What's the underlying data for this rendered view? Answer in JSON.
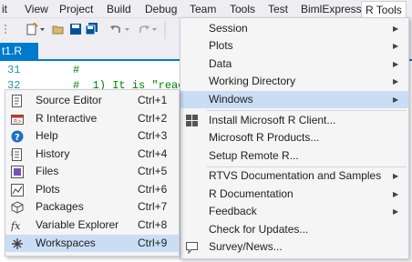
{
  "menubar": {
    "items": [
      "it",
      "View",
      "Project",
      "Build",
      "Debug",
      "Team",
      "Tools",
      "Test",
      "BimlExpress",
      "R Tools"
    ]
  },
  "tab": {
    "label": "t1.R"
  },
  "editor": {
    "lines": [
      {
        "num": "31",
        "code": "#"
      },
      {
        "num": "32",
        "code": "#  1) It is \"reacti"
      }
    ]
  },
  "rtools_menu": {
    "items": [
      {
        "label": "Session",
        "submenu": true
      },
      {
        "label": "Plots",
        "submenu": true
      },
      {
        "label": "Data",
        "submenu": true
      },
      {
        "label": "Working Directory",
        "submenu": true
      },
      {
        "label": "Windows",
        "submenu": true
      },
      {
        "label": "Install Microsoft R Client...",
        "submenu": false
      },
      {
        "label": "Microsoft R Products...",
        "submenu": false
      },
      {
        "label": "Setup Remote R...",
        "submenu": false
      },
      {
        "label": "RTVS Documentation and Samples",
        "submenu": true
      },
      {
        "label": "R Documentation",
        "submenu": true
      },
      {
        "label": "Feedback",
        "submenu": true
      },
      {
        "label": "Check for Updates...",
        "submenu": false
      },
      {
        "label": "Survey/News...",
        "submenu": false
      }
    ]
  },
  "windows_menu": {
    "items": [
      {
        "label": "Source Editor",
        "shortcut": "Ctrl+1",
        "icon": "source-editor-icon"
      },
      {
        "label": "R Interactive",
        "shortcut": "Ctrl+2",
        "icon": "r-interactive-icon"
      },
      {
        "label": "Help",
        "shortcut": "Ctrl+3",
        "icon": "help-icon"
      },
      {
        "label": "History",
        "shortcut": "Ctrl+4",
        "icon": "history-icon"
      },
      {
        "label": "Files",
        "shortcut": "Ctrl+5",
        "icon": "files-icon"
      },
      {
        "label": "Plots",
        "shortcut": "Ctrl+6",
        "icon": "plots-icon"
      },
      {
        "label": "Packages",
        "shortcut": "Ctrl+7",
        "icon": "packages-icon"
      },
      {
        "label": "Variable Explorer",
        "shortcut": "Ctrl+8",
        "icon": "variable-explorer-icon"
      },
      {
        "label": "Workspaces",
        "shortcut": "Ctrl+9",
        "icon": "workspaces-icon"
      }
    ]
  },
  "colors": {
    "accent": "#007acc",
    "highlight": "#c9def5",
    "menu_bg": "#f5f5f5",
    "comment": "#008000",
    "line_number": "#2b91af"
  }
}
